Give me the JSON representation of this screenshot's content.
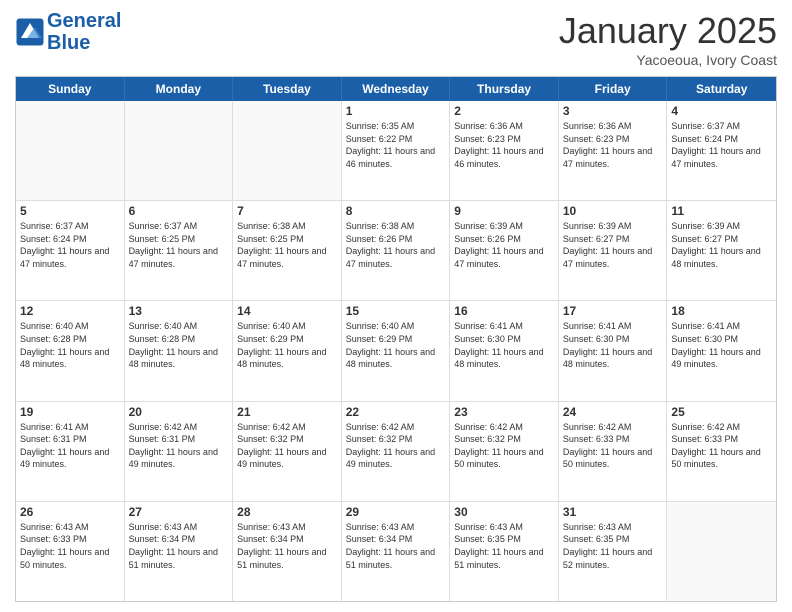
{
  "header": {
    "logo_line1": "General",
    "logo_line2": "Blue",
    "month_title": "January 2025",
    "location": "Yacoeoua, Ivory Coast"
  },
  "day_headers": [
    "Sunday",
    "Monday",
    "Tuesday",
    "Wednesday",
    "Thursday",
    "Friday",
    "Saturday"
  ],
  "weeks": [
    {
      "days": [
        {
          "num": "",
          "info": ""
        },
        {
          "num": "",
          "info": ""
        },
        {
          "num": "",
          "info": ""
        },
        {
          "num": "1",
          "info": "Sunrise: 6:35 AM\nSunset: 6:22 PM\nDaylight: 11 hours and 46 minutes."
        },
        {
          "num": "2",
          "info": "Sunrise: 6:36 AM\nSunset: 6:23 PM\nDaylight: 11 hours and 46 minutes."
        },
        {
          "num": "3",
          "info": "Sunrise: 6:36 AM\nSunset: 6:23 PM\nDaylight: 11 hours and 47 minutes."
        },
        {
          "num": "4",
          "info": "Sunrise: 6:37 AM\nSunset: 6:24 PM\nDaylight: 11 hours and 47 minutes."
        }
      ]
    },
    {
      "days": [
        {
          "num": "5",
          "info": "Sunrise: 6:37 AM\nSunset: 6:24 PM\nDaylight: 11 hours and 47 minutes."
        },
        {
          "num": "6",
          "info": "Sunrise: 6:37 AM\nSunset: 6:25 PM\nDaylight: 11 hours and 47 minutes."
        },
        {
          "num": "7",
          "info": "Sunrise: 6:38 AM\nSunset: 6:25 PM\nDaylight: 11 hours and 47 minutes."
        },
        {
          "num": "8",
          "info": "Sunrise: 6:38 AM\nSunset: 6:26 PM\nDaylight: 11 hours and 47 minutes."
        },
        {
          "num": "9",
          "info": "Sunrise: 6:39 AM\nSunset: 6:26 PM\nDaylight: 11 hours and 47 minutes."
        },
        {
          "num": "10",
          "info": "Sunrise: 6:39 AM\nSunset: 6:27 PM\nDaylight: 11 hours and 47 minutes."
        },
        {
          "num": "11",
          "info": "Sunrise: 6:39 AM\nSunset: 6:27 PM\nDaylight: 11 hours and 48 minutes."
        }
      ]
    },
    {
      "days": [
        {
          "num": "12",
          "info": "Sunrise: 6:40 AM\nSunset: 6:28 PM\nDaylight: 11 hours and 48 minutes."
        },
        {
          "num": "13",
          "info": "Sunrise: 6:40 AM\nSunset: 6:28 PM\nDaylight: 11 hours and 48 minutes."
        },
        {
          "num": "14",
          "info": "Sunrise: 6:40 AM\nSunset: 6:29 PM\nDaylight: 11 hours and 48 minutes."
        },
        {
          "num": "15",
          "info": "Sunrise: 6:40 AM\nSunset: 6:29 PM\nDaylight: 11 hours and 48 minutes."
        },
        {
          "num": "16",
          "info": "Sunrise: 6:41 AM\nSunset: 6:30 PM\nDaylight: 11 hours and 48 minutes."
        },
        {
          "num": "17",
          "info": "Sunrise: 6:41 AM\nSunset: 6:30 PM\nDaylight: 11 hours and 48 minutes."
        },
        {
          "num": "18",
          "info": "Sunrise: 6:41 AM\nSunset: 6:30 PM\nDaylight: 11 hours and 49 minutes."
        }
      ]
    },
    {
      "days": [
        {
          "num": "19",
          "info": "Sunrise: 6:41 AM\nSunset: 6:31 PM\nDaylight: 11 hours and 49 minutes."
        },
        {
          "num": "20",
          "info": "Sunrise: 6:42 AM\nSunset: 6:31 PM\nDaylight: 11 hours and 49 minutes."
        },
        {
          "num": "21",
          "info": "Sunrise: 6:42 AM\nSunset: 6:32 PM\nDaylight: 11 hours and 49 minutes."
        },
        {
          "num": "22",
          "info": "Sunrise: 6:42 AM\nSunset: 6:32 PM\nDaylight: 11 hours and 49 minutes."
        },
        {
          "num": "23",
          "info": "Sunrise: 6:42 AM\nSunset: 6:32 PM\nDaylight: 11 hours and 50 minutes."
        },
        {
          "num": "24",
          "info": "Sunrise: 6:42 AM\nSunset: 6:33 PM\nDaylight: 11 hours and 50 minutes."
        },
        {
          "num": "25",
          "info": "Sunrise: 6:42 AM\nSunset: 6:33 PM\nDaylight: 11 hours and 50 minutes."
        }
      ]
    },
    {
      "days": [
        {
          "num": "26",
          "info": "Sunrise: 6:43 AM\nSunset: 6:33 PM\nDaylight: 11 hours and 50 minutes."
        },
        {
          "num": "27",
          "info": "Sunrise: 6:43 AM\nSunset: 6:34 PM\nDaylight: 11 hours and 51 minutes."
        },
        {
          "num": "28",
          "info": "Sunrise: 6:43 AM\nSunset: 6:34 PM\nDaylight: 11 hours and 51 minutes."
        },
        {
          "num": "29",
          "info": "Sunrise: 6:43 AM\nSunset: 6:34 PM\nDaylight: 11 hours and 51 minutes."
        },
        {
          "num": "30",
          "info": "Sunrise: 6:43 AM\nSunset: 6:35 PM\nDaylight: 11 hours and 51 minutes."
        },
        {
          "num": "31",
          "info": "Sunrise: 6:43 AM\nSunset: 6:35 PM\nDaylight: 11 hours and 52 minutes."
        },
        {
          "num": "",
          "info": ""
        }
      ]
    }
  ]
}
